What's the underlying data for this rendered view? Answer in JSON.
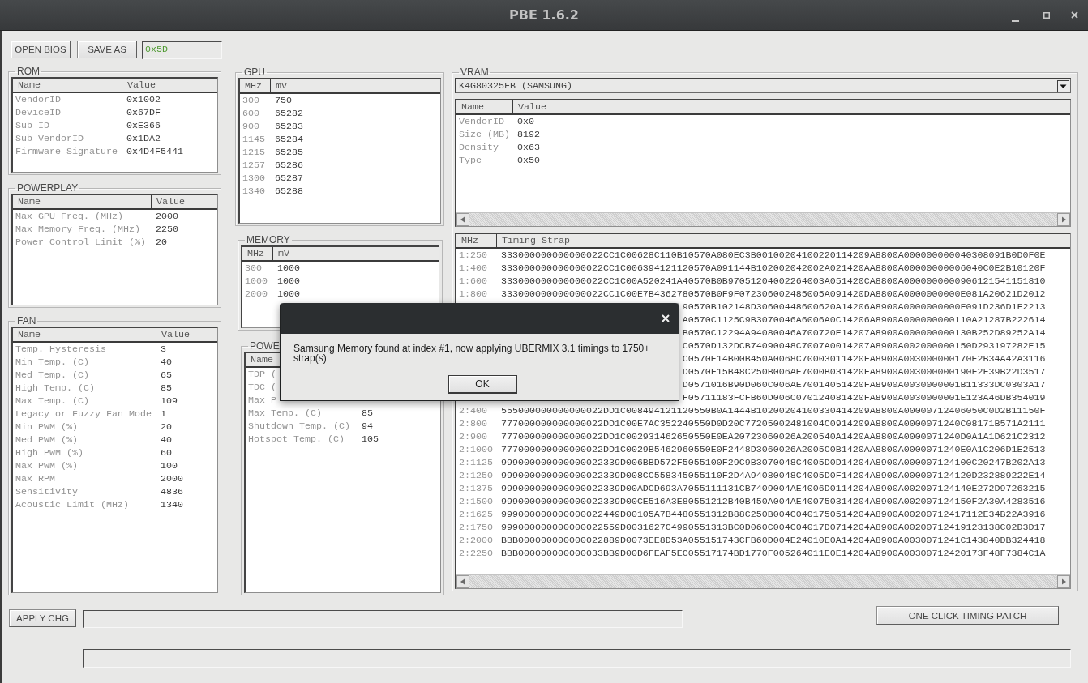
{
  "window": {
    "title": "PBE 1.6.2"
  },
  "toolbar": {
    "buttons": [
      "OPEN BIOS",
      "SAVE AS"
    ],
    "field": {
      "value": "0x5D"
    }
  },
  "rom": {
    "title": "ROM",
    "columns": [
      "Name",
      "Value"
    ],
    "rows": [
      [
        "VendorID",
        "0x1002"
      ],
      [
        "DeviceID",
        "0x67DF"
      ],
      [
        "Sub ID",
        "0xE366"
      ],
      [
        "Sub VendorID",
        "0x1DA2"
      ],
      [
        "Firmware Signature",
        "0x4D4F5441"
      ]
    ]
  },
  "powerplay": {
    "title": "POWERPLAY",
    "columns": [
      "Name",
      "Value"
    ],
    "rows": [
      [
        "Max GPU Freq. (MHz)",
        "2000"
      ],
      [
        "Max Memory Freq. (MHz)",
        "2250"
      ],
      [
        "Power Control Limit (%)",
        "20"
      ]
    ]
  },
  "fan": {
    "title": "FAN",
    "columns": [
      "Name",
      "Value"
    ],
    "rows": [
      [
        "Temp. Hysteresis",
        "3"
      ],
      [
        "Min Temp. (C)",
        "40"
      ],
      [
        "Med Temp. (C)",
        "65"
      ],
      [
        "High Temp. (C)",
        "85"
      ],
      [
        "Max Temp. (C)",
        "109"
      ],
      [
        "Legacy or Fuzzy Fan Mode",
        "1"
      ],
      [
        "Min PWM (%)",
        "20"
      ],
      [
        "Med PWM (%)",
        "40"
      ],
      [
        "High PWM (%)",
        "60"
      ],
      [
        "Max PWM (%)",
        "100"
      ],
      [
        "Max RPM",
        "2000"
      ],
      [
        "Sensitivity",
        "4836"
      ],
      [
        "Acoustic Limit (MHz)",
        "1340"
      ]
    ]
  },
  "gpu": {
    "title": "GPU",
    "columns": [
      "MHz",
      "mV"
    ],
    "rows": [
      [
        "300",
        "750"
      ],
      [
        "600",
        "65282"
      ],
      [
        "900",
        "65283"
      ],
      [
        "1145",
        "65284"
      ],
      [
        "1215",
        "65285"
      ],
      [
        "1257",
        "65286"
      ],
      [
        "1300",
        "65287"
      ],
      [
        "1340",
        "65288"
      ]
    ]
  },
  "memory": {
    "title": "MEMORY",
    "columns": [
      "MHz",
      "mV"
    ],
    "rows": [
      [
        "300",
        "1000"
      ],
      [
        "1000",
        "1000"
      ],
      [
        "2000",
        "1000"
      ]
    ]
  },
  "power": {
    "title": "POWE",
    "columns": [
      "Name"
    ],
    "rows": [
      [
        "TDP ("
      ],
      [
        "TDC ("
      ],
      [
        "Max P"
      ],
      [
        "Max Temp. (C)",
        "85"
      ],
      [
        "Shutdown Temp. (C)",
        "94"
      ],
      [
        "Hotspot Temp. (C)",
        "105"
      ]
    ]
  },
  "vram": {
    "title": "VRAM",
    "chip_dropdown": {
      "value": "K4G80325FB (SAMSUNG)"
    },
    "info_table": {
      "columns": [
        "Name",
        "Value"
      ],
      "rows": [
        [
          "VendorID",
          "0x0"
        ],
        [
          "Size (MB)",
          "8192"
        ],
        [
          "Density",
          "0x63"
        ],
        [
          "Type",
          "0x50"
        ]
      ]
    },
    "strap_table": {
      "columns": [
        "MHz",
        "Timing Strap"
      ],
      "rows": [
        {
          "mhz": "1:250",
          "strap": "333000000000000022CC1C00628C110B10570A080EC3B00100204100220114209A8800A000000000040308091B0D0F0E"
        },
        {
          "mhz": "1:400",
          "strap": "333000000000000022CC1C006394121120570A091144B102002042002A021420AA8800A00000000006040C0E2B10120F"
        },
        {
          "mhz": "1:600",
          "strap": "333000000000000022CC1C00A520241A40570B0B97051204002264003A051420CA8800A0000000000906121541151810"
        },
        {
          "mhz": "1:800",
          "strap": "333000000000000022CC1C00E7B4362780570B0F9F072306002485005A091420DA8800A0000000000E081A20621D2012"
        },
        {
          "strap": "90570B102148D30600448600620A14206A8900A0000000000F091D236D1F2213"
        },
        {
          "strap": "A0570C1125C9B3070046A6006A0C14206A8900A000000000110A21287B222614"
        },
        {
          "strap": "B0570C12294A94080046A700720E14207A8900A000000000130B252D89252A14"
        },
        {
          "strap": "C0570D132DCB74090048C7007A0014207A8900A002000000150D293197282E15"
        },
        {
          "strap": "C0570E14B00B450A0068C70003011420FA8900A003000000170E2B34A42A3116"
        },
        {
          "strap": "D0570F15B48C250B006AE7000B031420FA8900A003000000190F2F39B22D3517"
        },
        {
          "strap": "D0571016B90D060C006AE70014051420FA8900A0030000001B11333DC0303A17"
        },
        {
          "strap": "F05711183FCFB60D006C070124081420FA8900A0030000001E123A46DB354019"
        },
        {
          "mhz": "2:400",
          "strap": "555000000000000022DD1C008494121120550B0A1444B10200204100330414209A8800A00000712406050C0D2B11150F"
        },
        {
          "mhz": "2:800",
          "strap": "777000000000000022DD1C00E7AC352240550D0D20C77205002481004C0914209A8800A0000071240C08171B571A2111"
        },
        {
          "mhz": "2:900",
          "strap": "777000000000000022DD1C002931462650550E0EA20723060026A200540A1420AA8800A0000071240D0A1A1D621C2312"
        },
        {
          "mhz": "2:1000",
          "strap": "777000000000000022DD1C0029B5462960550E0F2448D3060026A2005C0B1420AA8800A0000071240E0A1C206D1E2513"
        },
        {
          "mhz": "2:1125",
          "strap": "999000000000000022339D006BBD572F5055100F29C9B3070048C4005D0D14204A8900A000007124100C20247B202A13"
        },
        {
          "mhz": "2:1250",
          "strap": "999000000000000022339D008CC558345055110F2D4A94080048C4005D0F14204A8900A000007124120D232889222E14"
        },
        {
          "mhz": "2:1375",
          "strap": "999000000000000022339D00ADCD693A7055111131CB7409004AE4006D0114204A8900A002007124140E272D97263215"
        },
        {
          "mhz": "2:1500",
          "strap": "999000000000000022339D00CE516A3E80551212B40B450A004AE400750314204A8900A002007124150F2A30A4283516"
        },
        {
          "mhz": "2:1625",
          "strap": "999000000000000022449D00105A7B4480551312B88C250B004C0401750514204A8900A00200712417112E34B22A3916"
        },
        {
          "mhz": "2:1750",
          "strap": "999000000000000022559D0031627C4990551313BC0D060C004C04017D0714204A8900A00200712419123138C02D3D17"
        },
        {
          "mhz": "2:2000",
          "strap": "BBB000000000000022889D0073EE8D53A055151743CFB60D004E24010E0A14204A8900A0030071241C143840DB324418"
        },
        {
          "mhz": "2:2250",
          "strap": "BBB000000000000033BB9D00D6FEAF5EC05517174BD1770F005264011E0E14204A8900A00300712420173F48F7384C1A"
        }
      ]
    }
  },
  "bottom": {
    "apply_button": "APPLY CHG",
    "patch_button": "ONE CLICK TIMING PATCH"
  },
  "dialog": {
    "message": "Samsung Memory found at index #1, now applying UBERMIX 3.1 timings to 1750+ strap(s)",
    "button": "OK"
  }
}
